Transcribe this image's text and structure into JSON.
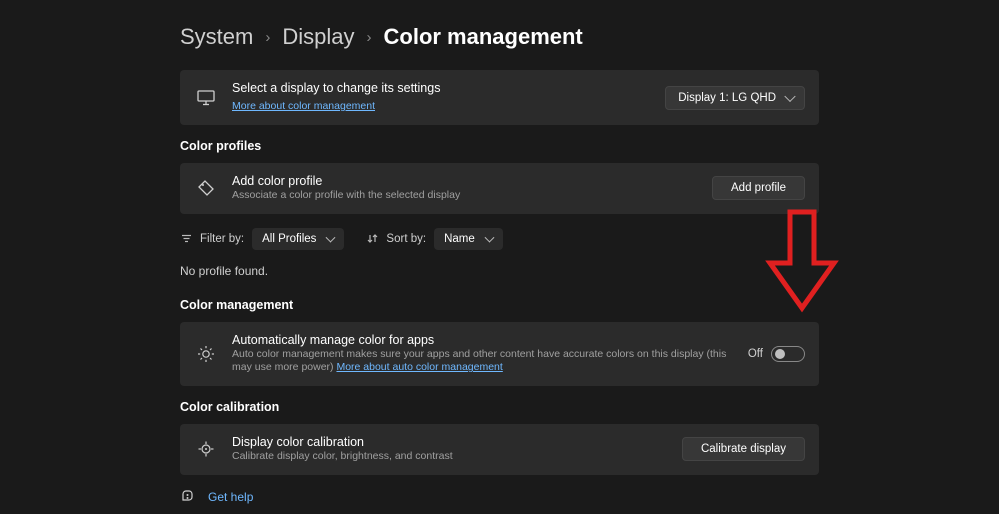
{
  "breadcrumb": {
    "system": "System",
    "display": "Display",
    "current": "Color management"
  },
  "display_select": {
    "title": "Select a display to change its settings",
    "link": "More about color management",
    "button": "Display 1: LG QHD"
  },
  "profiles": {
    "header": "Color profiles",
    "add_title": "Add color profile",
    "add_subtitle": "Associate a color profile with the selected display",
    "add_button": "Add profile",
    "filter_label": "Filter by:",
    "filter_value": "All Profiles",
    "sort_label": "Sort by:",
    "sort_value": "Name",
    "none": "No profile found."
  },
  "management": {
    "header": "Color management",
    "auto_title": "Automatically manage color for apps",
    "auto_subtitle_prefix": "Auto color management makes sure your apps and other content have accurate colors on this display (this may use more power) ",
    "auto_link": "More about auto color management",
    "toggle_state": "Off"
  },
  "calibration": {
    "header": "Color calibration",
    "title": "Display color calibration",
    "subtitle": "Calibrate display color, brightness, and contrast",
    "button": "Calibrate display"
  },
  "help": {
    "label": "Get help"
  }
}
